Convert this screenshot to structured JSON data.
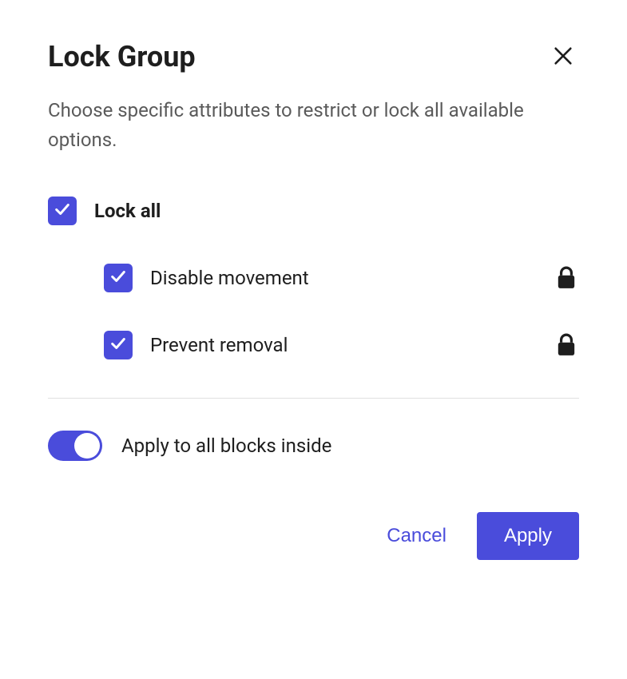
{
  "modal": {
    "title": "Lock Group",
    "description": "Choose specific attributes to restrict or lock all available options.",
    "lock_all_label": "Lock all",
    "disable_movement_label": "Disable movement",
    "prevent_removal_label": "Prevent removal",
    "apply_inside_label": "Apply to all blocks inside",
    "cancel_label": "Cancel",
    "apply_label": "Apply"
  },
  "state": {
    "lock_all_checked": true,
    "disable_movement_checked": true,
    "prevent_removal_checked": true,
    "apply_inside_on": true
  },
  "colors": {
    "accent": "#4a4cdb"
  }
}
